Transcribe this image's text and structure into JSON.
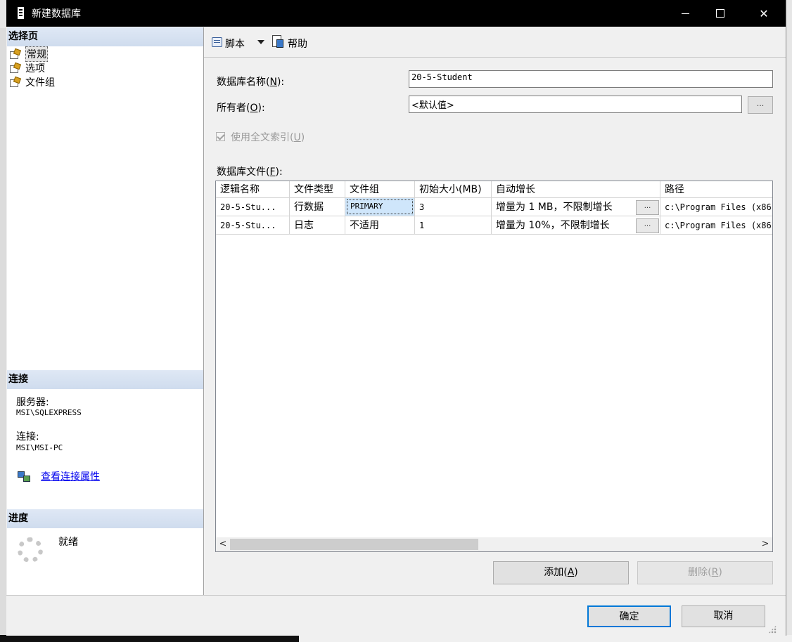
{
  "window": {
    "title": "新建数据库",
    "minimize": "—",
    "maximize": "□",
    "close": "✕"
  },
  "sidebar": {
    "select_page_header": "选择页",
    "pages": [
      {
        "label": "常规",
        "icon": "page-icon"
      },
      {
        "label": "选项",
        "icon": "page-icon"
      },
      {
        "label": "文件组",
        "icon": "page-icon"
      }
    ],
    "connection_header": "连接",
    "server_label": "服务器:",
    "server_value": "MSI\\SQLEXPRESS",
    "connection_label": "连接:",
    "connection_value": "MSI\\MSI-PC",
    "view_connection_link": "查看连接属性",
    "progress_header": "进度",
    "progress_status": "就绪"
  },
  "toolbar": {
    "script_label": "脚本",
    "help_label": "帮助"
  },
  "form": {
    "db_name_label": "数据库名称",
    "db_name_key": "N",
    "db_name_value": "20-5-Student",
    "owner_label": "所有者",
    "owner_key": "O",
    "owner_value": "<默认值>",
    "owner_browse": "...",
    "fulltext_label": "使用全文索引",
    "fulltext_key": "U",
    "fulltext_checked": true,
    "files_label": "数据库文件",
    "files_key": "F"
  },
  "files_grid": {
    "columns": [
      "逻辑名称",
      "文件类型",
      "文件组",
      "初始大小(MB)",
      "自动增长",
      "路径"
    ],
    "rows": [
      {
        "logical_name": "20-5-Stu...",
        "file_type": "行数据",
        "filegroup": "PRIMARY",
        "initial_size": "3",
        "autogrowth": "增量为 1 MB，不限制增长",
        "autogrowth_btn": "...",
        "path": "c:\\Program Files (x86"
      },
      {
        "logical_name": "20-5-Stu...",
        "file_type": "日志",
        "filegroup": "不适用",
        "initial_size": "1",
        "autogrowth": "增量为 10%，不限制增长",
        "autogrowth_btn": "...",
        "path": "c:\\Program Files (x86"
      }
    ],
    "scroll_left": "<",
    "scroll_right": ">"
  },
  "buttons": {
    "add_label": "添加",
    "add_key": "A",
    "remove_label": "删除",
    "remove_key": "R",
    "ok_label": "确定",
    "cancel_label": "取消"
  }
}
